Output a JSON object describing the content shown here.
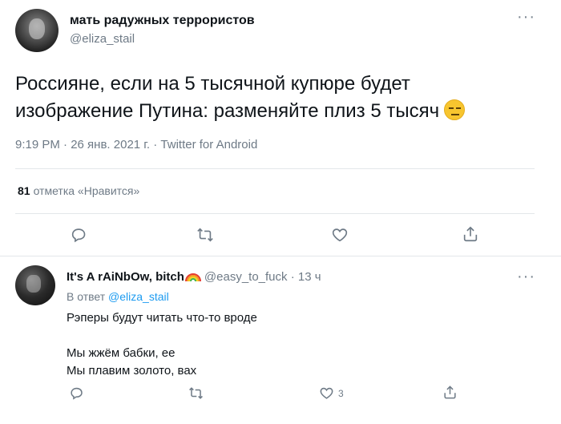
{
  "tweet": {
    "author_name": "мать радужных террористов",
    "author_handle": "@eliza_stail",
    "text": "Россияне, если на 5 тысячной купюре будет изображение Путина: разменяйте плиз 5 тысяч",
    "emoji_icon": "expressionless-face-emoji",
    "meta": "9:19 PM · 26 янв. 2021 г. · Twitter for Android",
    "likes_count": "81",
    "likes_label": "отметка «Нравится»",
    "actions": [
      "reply",
      "retweet",
      "like",
      "share"
    ],
    "more_icon": "more-dots-icon"
  },
  "reply": {
    "author_name": "It's A rAiNbOw, bitch",
    "author_emoji": "rainbow-emoji",
    "author_handle": "@easy_to_fuck · 13 ч",
    "in_reply_prefix": "В ответ",
    "in_reply_handle": "@eliza_stail",
    "lines": [
      "Рэперы будут читать что-то вроде",
      "",
      "Мы жжём бабки, ее",
      "Мы плавим золото, вах"
    ],
    "like_count": "3",
    "actions": [
      "reply",
      "retweet",
      "like",
      "share"
    ]
  }
}
